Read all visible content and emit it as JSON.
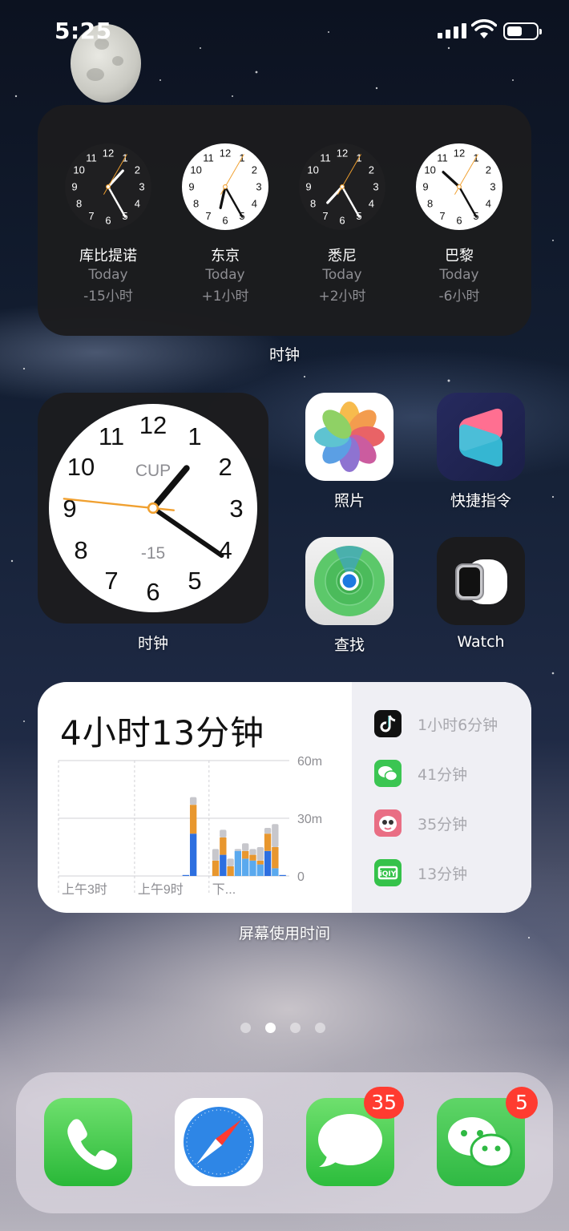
{
  "status_bar": {
    "time": "5:25"
  },
  "world_clock": {
    "clocks": [
      {
        "city": "库比提诺",
        "day": "Today",
        "offset": "-15小时",
        "hour": 1,
        "minute": 25,
        "second": 5
      },
      {
        "city": "东京",
        "day": "Today",
        "offset": "+1小时",
        "hour": 6,
        "minute": 25,
        "second": 5
      },
      {
        "city": "悉尼",
        "day": "Today",
        "offset": "+2小时",
        "hour": 7,
        "minute": 25,
        "second": 5
      },
      {
        "city": "巴黎",
        "day": "Today",
        "offset": "-6小时",
        "hour": 10,
        "minute": 25,
        "second": 5
      }
    ],
    "label": "时钟"
  },
  "big_clock": {
    "city_code": "CUP",
    "offset": "-15",
    "hour": 1,
    "minute": 20,
    "second": 46,
    "label": "时钟"
  },
  "apps": {
    "photos": "照片",
    "shortcuts": "快捷指令",
    "find_my": "查找",
    "watch": "Watch"
  },
  "screen_time": {
    "total": "4小时13分钟",
    "y_labels": [
      "60m",
      "30m",
      "0"
    ],
    "x_labels": [
      "上午3时",
      "上午9时",
      "下..."
    ],
    "apps": [
      {
        "icon": "tiktok-icon",
        "value": "1小时6分钟"
      },
      {
        "icon": "wechat-icon",
        "value": "41分钟"
      },
      {
        "icon": "game-app-icon",
        "value": "35分钟"
      },
      {
        "icon": "iqiyi-icon",
        "value": "13分钟"
      }
    ],
    "label": "屏幕使用时间",
    "chart_data": {
      "type": "bar",
      "stacked": true,
      "ylim": [
        0,
        60
      ],
      "bars": [
        {
          "slot": 17,
          "segments": [
            0.5,
            0,
            0,
            0
          ]
        },
        {
          "slot": 18,
          "segments": [
            22,
            0,
            15,
            4
          ]
        },
        {
          "slot": 21,
          "segments": [
            0,
            0,
            8,
            6
          ]
        },
        {
          "slot": 22,
          "segments": [
            11,
            0,
            9,
            4
          ]
        },
        {
          "slot": 23,
          "segments": [
            0,
            0,
            5,
            4
          ]
        },
        {
          "slot": 24,
          "segments": [
            0,
            13,
            0,
            1
          ]
        },
        {
          "slot": 25,
          "segments": [
            0,
            9,
            4,
            4
          ]
        },
        {
          "slot": 26,
          "segments": [
            0,
            8,
            3,
            3
          ]
        },
        {
          "slot": 27,
          "segments": [
            0,
            6,
            2,
            7
          ]
        },
        {
          "slot": 28,
          "segments": [
            13,
            0,
            9,
            3
          ]
        },
        {
          "slot": 29,
          "segments": [
            0,
            4,
            11,
            12
          ]
        },
        {
          "slot": 30,
          "segments": [
            0.5,
            0,
            0,
            0
          ]
        }
      ],
      "slots": 31,
      "segment_colors": [
        "#2d6fe0",
        "#5aa9ee",
        "#e8972e",
        "#c7c7cc"
      ]
    }
  },
  "dock": {
    "phone": "phone-icon",
    "safari": "safari-icon",
    "messages_badge": "35",
    "wechat_badge": "5"
  },
  "page_dots": {
    "count": 4,
    "active": 1
  }
}
